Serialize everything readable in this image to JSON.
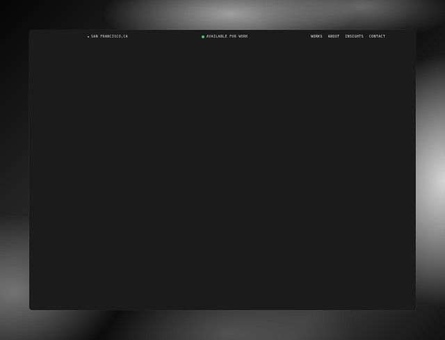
{
  "header": {
    "location": "SAN FRANCISCO,CA",
    "status": "AVAILABLE FOR WORK",
    "status_color": "#3fd163",
    "nav": [
      {
        "label": "WORKS"
      },
      {
        "label": "ABOUT"
      },
      {
        "label": "INSIGHTS"
      },
      {
        "label": "CONTACT"
      }
    ]
  }
}
